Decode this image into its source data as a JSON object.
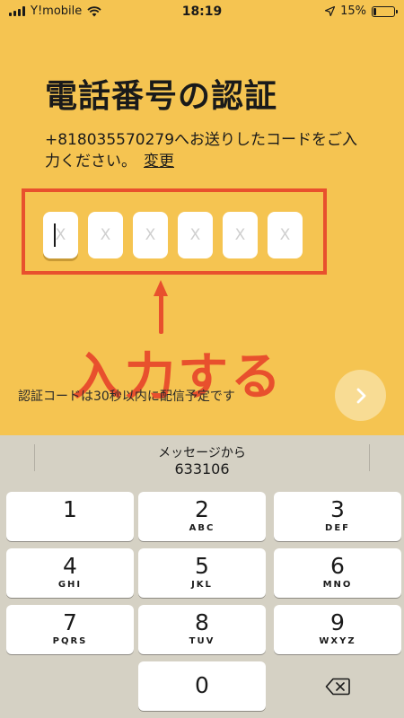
{
  "status": {
    "carrier": "Y!mobile",
    "time": "18:19",
    "battery_percent": "15%",
    "battery_level": 0.15
  },
  "title": "電話番号の認証",
  "description": {
    "text": "+818035570279へお送りしたコードをご入力ください。",
    "change_link": "変更"
  },
  "code_slots": {
    "placeholder": "X",
    "count": 6
  },
  "annotation": "入力する",
  "notice": "認証コードは30秒以内に配信予定です",
  "keyboard": {
    "suggestion_label": "メッセージから",
    "suggestion_code": "633106",
    "keys": [
      {
        "num": "1",
        "letters": ""
      },
      {
        "num": "2",
        "letters": "ABC"
      },
      {
        "num": "3",
        "letters": "DEF"
      },
      {
        "num": "4",
        "letters": "GHI"
      },
      {
        "num": "5",
        "letters": "JKL"
      },
      {
        "num": "6",
        "letters": "MNO"
      },
      {
        "num": "7",
        "letters": "PQRS"
      },
      {
        "num": "8",
        "letters": "TUV"
      },
      {
        "num": "9",
        "letters": "WXYZ"
      },
      {
        "num": "0",
        "letters": ""
      }
    ]
  },
  "colors": {
    "background": "#f5c451",
    "annotation_red": "#e8502d",
    "next_button": "#f8dc94"
  }
}
